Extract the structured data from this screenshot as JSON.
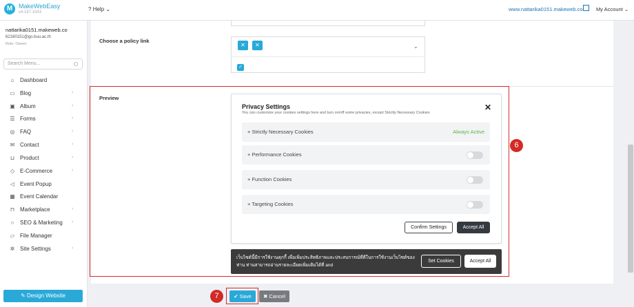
{
  "header": {
    "brand": "MakeWebEasy",
    "version": "v4.167.1043",
    "help": "Help",
    "site_link": "www.nattarika0151.makeweb.co",
    "account": "My Account"
  },
  "user": {
    "name": "nattarika0151.makeweb.co",
    "email": "62160151@go.buu.ac.th",
    "role": "Role: Owner"
  },
  "search": {
    "placeholder": "Search Menu..."
  },
  "menu": [
    {
      "label": "Dashboard",
      "icon": "home-icon"
    },
    {
      "label": "Blog",
      "icon": "file-icon"
    },
    {
      "label": "Album",
      "icon": "image-icon"
    },
    {
      "label": "Forms",
      "icon": "list-icon"
    },
    {
      "label": "FAQ",
      "icon": "chat-icon"
    },
    {
      "label": "Contact",
      "icon": "mail-icon"
    },
    {
      "label": "Product",
      "icon": "cart-icon"
    },
    {
      "label": "E-Commerce",
      "icon": "tag-icon"
    },
    {
      "label": "Event Popup",
      "icon": "megaphone-icon"
    },
    {
      "label": "Event Calendar",
      "icon": "calendar-icon"
    },
    {
      "label": "Marketplace",
      "icon": "bag-icon"
    },
    {
      "label": "SEO & Marketing",
      "icon": "search-icon"
    },
    {
      "label": "File Manager",
      "icon": "folder-icon"
    },
    {
      "label": "Site Settings",
      "icon": "gear-icon"
    }
  ],
  "design_button": "Design Website",
  "form": {
    "policy_label": "Choose a policy link",
    "preview_label": "Preview"
  },
  "privacy": {
    "title": "Privacy Settings",
    "subtitle": "You can customize your cookies settings here and turn on/off some privacies, except Strictly Necessary Cookies",
    "cookies": [
      {
        "label": "+ Strictly Necessary Cookies",
        "state": "Always Active"
      },
      {
        "label": "+ Performance Cookies",
        "enabled": false
      },
      {
        "label": "+ Function Cookies",
        "enabled": false
      },
      {
        "label": "+ Targeting Cookies",
        "enabled": false
      }
    ],
    "confirm": "Confirm Settings",
    "accept_all": "Accept All"
  },
  "banner": {
    "text": "เว็บไซต์นี้มีการใช้งานคุกกี้ เพื่อเพิ่มประสิทธิภาพและประสบการณ์ที่ดีในการใช้งานเว็บไซต์ของท่าน ท่านสามารถอ่านรายละเอียดเพิ่มเติมได้ที่ and",
    "set_cookies": "Set Cookies",
    "accept_all": "Accept All"
  },
  "footer": {
    "save": "Save",
    "cancel": "Cancel"
  },
  "annotations": {
    "step6": "6",
    "step7": "7"
  },
  "colors": {
    "accent": "#2aa9d8",
    "highlight": "#d62b2b",
    "active_green": "#5bb54a"
  }
}
